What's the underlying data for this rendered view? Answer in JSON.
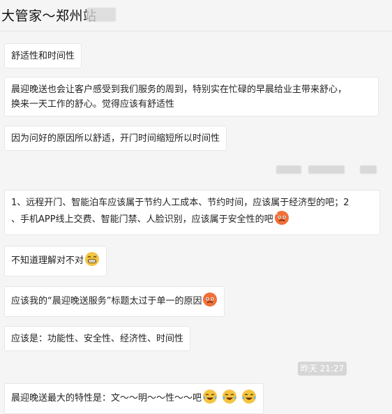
{
  "header": {
    "title": "大管家～郑州站"
  },
  "messages": [
    {
      "text": "舒适性和时间性"
    },
    {
      "text_line1": "晨迎晚送也会让客户感受到我们服务的周到，特别实在忙碌的早晨给业主带来舒心，",
      "text_line2": "换来一天工作的舒心。觉得应该有舒适性"
    },
    {
      "text": "因为问好的原因所以舒适，开门时间缩短所以时间性"
    },
    {
      "text_line1": "1、远程开门、智能泊车应该属于节约人工成本、节约时间，应该属于经济型的吧；2",
      "text_line2": "、手机APP线上交费、智能门禁、人脸识别，应该属于安全性的吧",
      "emoji": "sweat-hot-face"
    },
    {
      "text": "不知道理解对不对",
      "emoji": "grin-sweat-face"
    },
    {
      "text": "应该我的“晨迎晚送服务”标题太过于单一的原因",
      "emoji": "sweat-hot-face"
    },
    {
      "text": "应该是：功能性、安全性、经济性、时间性"
    },
    {
      "text": "晨迎晚送最大的特性是：文～～明～～性～～吧",
      "emoji": "tears-of-joy-face"
    }
  ],
  "timestamp": "昨天 21:27",
  "colors": {
    "background": "#f5f5f5",
    "bubble": "#ffffff",
    "emoji_orange": "#f0703a",
    "emoji_yellow": "#f5c542"
  }
}
